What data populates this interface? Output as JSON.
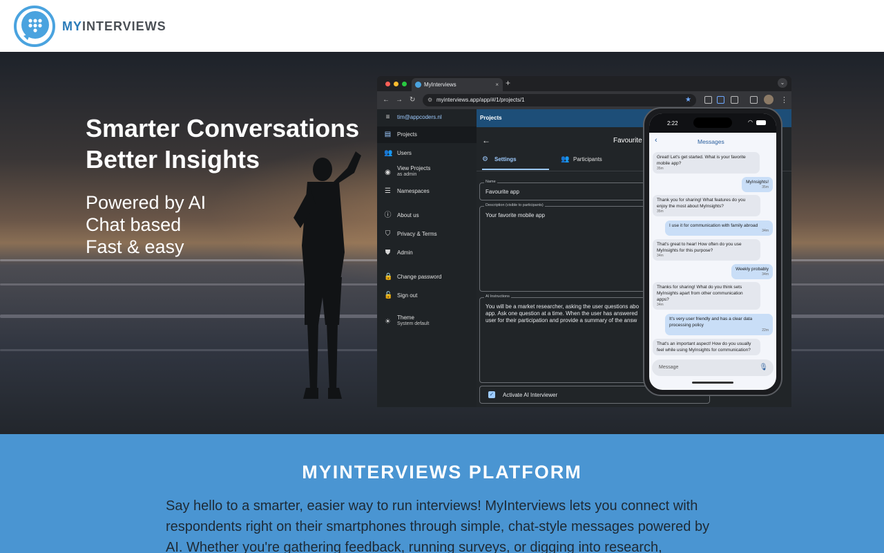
{
  "header": {
    "brand_a": "MY",
    "brand_b": "INTERVIEWS"
  },
  "hero": {
    "headline_1": "Smarter Conversations",
    "headline_2": "Better Insights",
    "features": [
      "Powered by AI",
      "Chat based",
      "Fast & easy"
    ]
  },
  "browser": {
    "tab_title": "MyInterviews",
    "tab_close": "×",
    "new_tab": "+",
    "url": "myinterviews.app/app/#/1/projects/1"
  },
  "app": {
    "user": "tim@appcoders.nl",
    "sidebar": [
      {
        "label": "Projects"
      },
      {
        "label": "Users"
      },
      {
        "label": "View Projects",
        "sub": "as admin"
      },
      {
        "label": "Namespaces"
      },
      {
        "label": "About us"
      },
      {
        "label": "Privacy & Terms"
      },
      {
        "label": "Admin"
      },
      {
        "label": "Change password"
      },
      {
        "label": "Sign out"
      },
      {
        "label": "Theme",
        "sub": "System default"
      }
    ],
    "appbar_title": "Projects",
    "project_title": "Favourite",
    "tabs": [
      "Settings",
      "Participants"
    ],
    "name_label": "Name",
    "name_value": "Favourite app",
    "description_label": "Description (visible to participants)",
    "description_value": "Your favorite mobile app",
    "ai_label": "AI Instructions",
    "ai_value": "You will be a market researcher, asking the user questions abo app. Ask one question at a time. When the user has answered user for their participation and provide a summary of the answ",
    "activate_label": "Activate AI Interviewer"
  },
  "phone": {
    "time": "2:22",
    "title": "Messages",
    "messages": [
      {
        "from": "bot",
        "text": "Great! Let's get started. What is your favorite mobile app?",
        "time": "35m"
      },
      {
        "from": "user",
        "text": "MyInsights!",
        "time": "35m"
      },
      {
        "from": "bot",
        "text": "Thank you for sharing! What features do you enjoy the most about MyInsights?",
        "time": "35m"
      },
      {
        "from": "user",
        "text": "I use it for communication with family abroad",
        "time": "34m"
      },
      {
        "from": "bot",
        "text": "That's great to hear! How often do you use MyInsights for this purpose?",
        "time": "34m"
      },
      {
        "from": "user",
        "text": "Weekly probably",
        "time": "34m"
      },
      {
        "from": "bot",
        "text": "Thanks for sharing! What do you think sets MyInsights apart from other communication apps?",
        "time": "34m"
      },
      {
        "from": "user",
        "text": "It's very user friendly and has a clear data processing policy",
        "time": "22m"
      },
      {
        "from": "bot",
        "text": "That's an important aspect! How do you usually feel while using MyInsights for communication?",
        "time": ""
      }
    ],
    "composer_placeholder": "Message"
  },
  "platform": {
    "title": "MYINTERVIEWS PLATFORM",
    "body": "Say hello to a smarter, easier way to run interviews! MyInterviews lets you connect with respondents right on their smartphones through simple, chat-style messages powered by AI. Whether you're gathering feedback, running surveys, or digging into research, MyInterviews"
  },
  "colors": {
    "brand_blue": "#2a7ab8",
    "section_blue": "#4a95d2",
    "appbar": "#1d4e78"
  }
}
